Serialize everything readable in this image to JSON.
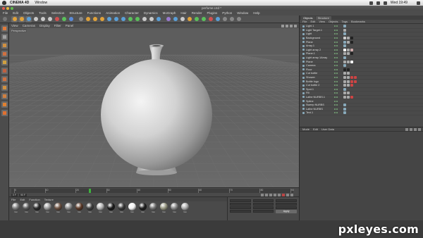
{
  "macbar": {
    "app_name": "CINEMA 4D",
    "menu": "Window",
    "clock": "Wed 19:49"
  },
  "window": {
    "title": "perfume.c4d *"
  },
  "c4d_menu": [
    "File",
    "Edit",
    "Objects",
    "Tools",
    "Selection",
    "Structure",
    "Functions",
    "Animation",
    "Character",
    "Dynamics",
    "MoGraph",
    "Hair",
    "Render",
    "Plugins",
    "Python",
    "Window",
    "Help"
  ],
  "viewport": {
    "menu": [
      "View",
      "Cameras",
      "Display",
      "Filter",
      "Panel"
    ],
    "label": "Perspective"
  },
  "timeline": {
    "ticks": [
      "0",
      "10",
      "20",
      "30",
      "40",
      "50",
      "60",
      "70",
      "80",
      "90"
    ],
    "playhead_fraction": 0.27,
    "start_field": "0 F",
    "end_field": "90 F"
  },
  "materials": {
    "menu": [
      "File",
      "Edit",
      "Function",
      "Texture"
    ],
    "swatches": [
      {
        "label": "Mat",
        "color": "#7b7b7b"
      },
      {
        "label": "Mat",
        "color": "#5a5a5a"
      },
      {
        "label": "Mat",
        "color": "#2b2b2b"
      },
      {
        "label": "Mat",
        "color": "#9a9a9a"
      },
      {
        "label": "Mat",
        "color": "#6b5040"
      },
      {
        "label": "Mat",
        "color": "#8a8a8a"
      },
      {
        "label": "Mat",
        "color": "#5c3a28"
      },
      {
        "label": "Mat",
        "color": "#404040"
      },
      {
        "label": "Mat",
        "color": "#b2b2b2"
      },
      {
        "label": "Mat",
        "color": "#1a1a1a"
      },
      {
        "label": "Mat",
        "color": "#3a3a3a"
      },
      {
        "label": "Mat",
        "color": "#f0f0f0"
      },
      {
        "label": "Mat",
        "color": "#1f1f1f"
      },
      {
        "label": "Mat",
        "color": "#707070"
      },
      {
        "label": "Mat",
        "color": "#959580"
      },
      {
        "label": "Mat",
        "color": "#858585"
      },
      {
        "label": "Mat",
        "color": "#aaaaaa"
      }
    ]
  },
  "coords": {
    "apply_label": "Apply"
  },
  "objects": {
    "tabs": [
      "Objects",
      "Structure"
    ],
    "menu": [
      "File",
      "Edit",
      "View",
      "Objects",
      "Tags",
      "Bookmarks"
    ],
    "rows": [
      {
        "name": "Light.1",
        "tags": [
          "#8ab"
        ]
      },
      {
        "name": "Light Target.1",
        "tags": [
          "#aaa"
        ]
      },
      {
        "name": "Light",
        "tags": [
          "#8ab"
        ]
      },
      {
        "name": "Background",
        "tags": [
          "#ccc",
          "#aaa",
          "#222"
        ]
      },
      {
        "name": "Plane",
        "tags": [
          "#8ab",
          "#aaa",
          "#222"
        ]
      },
      {
        "name": "Array.1",
        "tags": [
          "#8ab"
        ]
      },
      {
        "name": "Light array 2",
        "tags": [
          "#fff",
          "#aaa",
          "#caa"
        ]
      },
      {
        "name": "Plane.1",
        "tags": [
          "#aaa",
          "#aaa",
          "#222"
        ]
      },
      {
        "name": "Light array 1Array",
        "tags": [
          "#8ab"
        ]
      },
      {
        "name": "Plane",
        "tags": [
          "#aaa",
          "#aaa",
          "#fff"
        ]
      },
      {
        "name": "Camera",
        "tags": [
          "#8ab"
        ]
      },
      {
        "name": "Floor",
        "tags": [
          "#222",
          "#222"
        ]
      },
      {
        "name": "Cut bottle",
        "tags": [
          "#aaa",
          "#aaa"
        ]
      },
      {
        "name": "Shower",
        "tags": [
          "#aaa",
          "#aaa",
          "#c44",
          "#c44"
        ]
      },
      {
        "name": "Bottle logo",
        "tags": [
          "#aaa",
          "#aaa",
          "#c44",
          "#c44"
        ]
      },
      {
        "name": "Cut bottle 2",
        "tags": [
          "#aaa",
          "#aaa",
          "#c44"
        ]
      },
      {
        "name": "Spot.1",
        "tags": [
          "#8ab"
        ]
      },
      {
        "name": "Fill",
        "tags": [
          "#aaa",
          "#aaa"
        ]
      },
      {
        "name": "Lathe NURBS.1",
        "tags": [
          "#aaa",
          "#aaa",
          "#c44"
        ]
      },
      {
        "name": "Spline",
        "tags": []
      },
      {
        "name": "Sweep NURBS",
        "tags": [
          "#8ab"
        ]
      },
      {
        "name": "Lathe NURBS",
        "tags": [
          "#8ab"
        ]
      },
      {
        "name": "Text.1",
        "tags": [
          "#8ab"
        ]
      }
    ]
  },
  "attributes": {
    "menu": [
      "Mode",
      "Edit",
      "User Data"
    ]
  },
  "watermark": "pxleyes.com"
}
